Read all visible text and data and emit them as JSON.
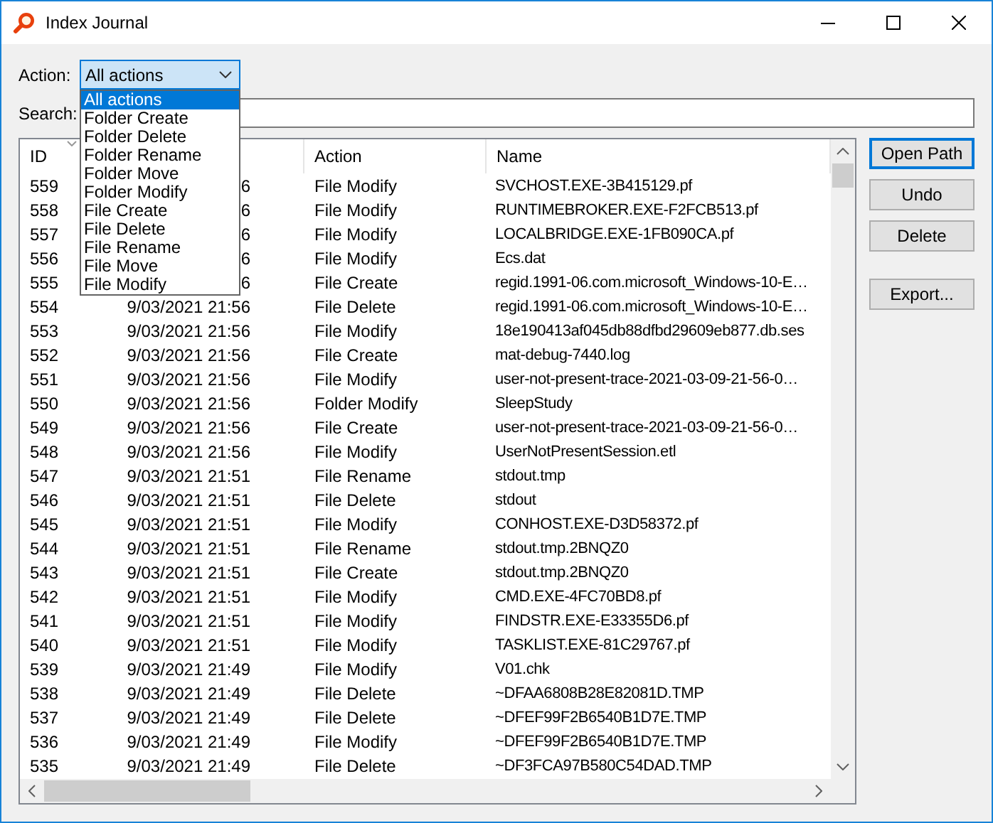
{
  "window": {
    "title": "Index Journal"
  },
  "action_filter": {
    "label": "Action:",
    "value": "All actions",
    "expanded": true,
    "options": [
      {
        "label": "All actions",
        "selected": true
      },
      {
        "label": "Folder Create",
        "selected": false
      },
      {
        "label": "Folder Delete",
        "selected": false
      },
      {
        "label": "Folder Rename",
        "selected": false
      },
      {
        "label": "Folder Move",
        "selected": false
      },
      {
        "label": "Folder Modify",
        "selected": false
      },
      {
        "label": "File Create",
        "selected": false
      },
      {
        "label": "File Delete",
        "selected": false
      },
      {
        "label": "File Rename",
        "selected": false
      },
      {
        "label": "File Move",
        "selected": false
      },
      {
        "label": "File Modify",
        "selected": false
      }
    ]
  },
  "search": {
    "label": "Search:"
  },
  "table": {
    "columns": [
      {
        "label": "ID",
        "sorted": true
      },
      {
        "label": "Action",
        "sorted": false
      },
      {
        "label": "Name",
        "sorted": false
      }
    ],
    "rows": [
      {
        "id": "559",
        "column_2": "6",
        "action": "File Modify",
        "name": "SVCHOST.EXE-3B415129.pf"
      },
      {
        "id": "558",
        "column_2": "6",
        "action": "File Modify",
        "name": "RUNTIMEBROKER.EXE-F2FCB513.pf"
      },
      {
        "id": "557",
        "column_2": "6",
        "action": "File Modify",
        "name": "LOCALBRIDGE.EXE-1FB090CA.pf"
      },
      {
        "id": "556",
        "column_2": "6",
        "action": "File Modify",
        "name": "Ecs.dat"
      },
      {
        "id": "555",
        "column_2": "6",
        "action": "File Create",
        "name": "regid.1991-06.com.microsoft_Windows-10-E…"
      },
      {
        "id": "554",
        "column_2": "9/03/2021 21:56",
        "action": "File Delete",
        "name": "regid.1991-06.com.microsoft_Windows-10-E…"
      },
      {
        "id": "553",
        "column_2": "9/03/2021 21:56",
        "action": "File Modify",
        "name": "18e190413af045db88dfbd29609eb877.db.ses"
      },
      {
        "id": "552",
        "column_2": "9/03/2021 21:56",
        "action": "File Create",
        "name": "mat-debug-7440.log"
      },
      {
        "id": "551",
        "column_2": "9/03/2021 21:56",
        "action": "File Modify",
        "name": "user-not-present-trace-2021-03-09-21-56-0…"
      },
      {
        "id": "550",
        "column_2": "9/03/2021 21:56",
        "action": "Folder Modify",
        "name": "SleepStudy"
      },
      {
        "id": "549",
        "column_2": "9/03/2021 21:56",
        "action": "File Create",
        "name": "user-not-present-trace-2021-03-09-21-56-0…"
      },
      {
        "id": "548",
        "column_2": "9/03/2021 21:56",
        "action": "File Modify",
        "name": "UserNotPresentSession.etl"
      },
      {
        "id": "547",
        "column_2": "9/03/2021 21:51",
        "action": "File Rename",
        "name": "stdout.tmp"
      },
      {
        "id": "546",
        "column_2": "9/03/2021 21:51",
        "action": "File Delete",
        "name": "stdout"
      },
      {
        "id": "545",
        "column_2": "9/03/2021 21:51",
        "action": "File Modify",
        "name": "CONHOST.EXE-D3D58372.pf"
      },
      {
        "id": "544",
        "column_2": "9/03/2021 21:51",
        "action": "File Rename",
        "name": "stdout.tmp.2BNQZ0"
      },
      {
        "id": "543",
        "column_2": "9/03/2021 21:51",
        "action": "File Create",
        "name": "stdout.tmp.2BNQZ0"
      },
      {
        "id": "542",
        "column_2": "9/03/2021 21:51",
        "action": "File Modify",
        "name": "CMD.EXE-4FC70BD8.pf"
      },
      {
        "id": "541",
        "column_2": "9/03/2021 21:51",
        "action": "File Modify",
        "name": "FINDSTR.EXE-E33355D6.pf"
      },
      {
        "id": "540",
        "column_2": "9/03/2021 21:51",
        "action": "File Modify",
        "name": "TASKLIST.EXE-81C29767.pf"
      },
      {
        "id": "539",
        "column_2": "9/03/2021 21:49",
        "action": "File Modify",
        "name": "V01.chk"
      },
      {
        "id": "538",
        "column_2": "9/03/2021 21:49",
        "action": "File Delete",
        "name": "~DFAA6808B28E82081D.TMP"
      },
      {
        "id": "537",
        "column_2": "9/03/2021 21:49",
        "action": "File Delete",
        "name": "~DFEF99F2B6540B1D7E.TMP"
      },
      {
        "id": "536",
        "column_2": "9/03/2021 21:49",
        "action": "File Modify",
        "name": "~DFEF99F2B6540B1D7E.TMP"
      },
      {
        "id": "535",
        "column_2": "9/03/2021 21:49",
        "action": "File Delete",
        "name": "~DF3FCA97B580C54DAD.TMP"
      }
    ]
  },
  "button_groups": [
    [
      {
        "label": "Open Path",
        "default": true
      },
      {
        "label": "Undo",
        "default": false
      },
      {
        "label": "Delete",
        "default": false
      }
    ],
    [
      {
        "label": "Export...",
        "default": false
      }
    ]
  ]
}
